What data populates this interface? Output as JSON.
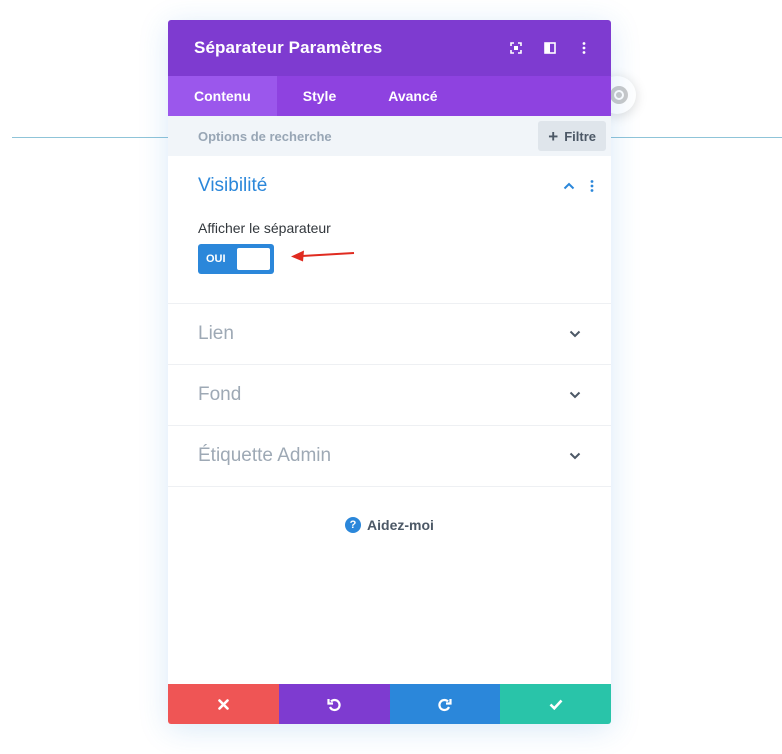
{
  "modal": {
    "title": "Séparateur Paramètres",
    "header_icons": [
      "fullscreen-icon",
      "split-view-icon",
      "more-vertical-icon"
    ]
  },
  "tabs": [
    {
      "label": "Contenu",
      "active": true
    },
    {
      "label": "Style",
      "active": false
    },
    {
      "label": "Avancé",
      "active": false
    }
  ],
  "search": {
    "placeholder": "Options de recherche",
    "filter_label": "Filtre"
  },
  "sections": {
    "visibility": {
      "title": "Visibilité",
      "expanded": true,
      "field_label": "Afficher le séparateur",
      "toggle_label": "OUI",
      "toggle_on": true
    },
    "collapsed": [
      {
        "title": "Lien"
      },
      {
        "title": "Fond"
      },
      {
        "title": "Étiquette Admin"
      }
    ]
  },
  "help": {
    "label": "Aidez-moi"
  },
  "colors": {
    "header": "#7e3bd0",
    "tabs": "#8e42e0",
    "accent_blue": "#2b87da",
    "cancel": "#ef5555",
    "save": "#29c4a9",
    "annotation_arrow": "#e02b20"
  }
}
